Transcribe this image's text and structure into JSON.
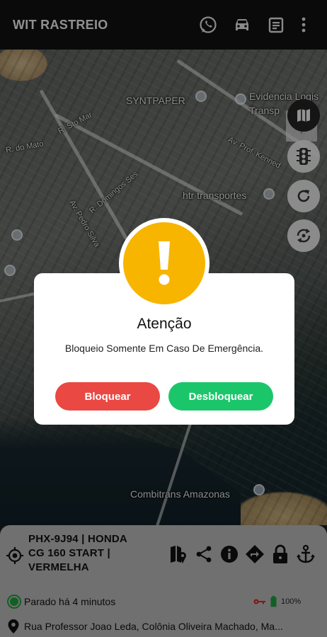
{
  "app": {
    "title": "WIT RASTREIO"
  },
  "toolbar": {
    "icons": [
      "whatsapp-icon",
      "car-icon",
      "calendar-icon",
      "more-vertical-icon"
    ]
  },
  "map": {
    "labels": {
      "syntpaper": "SYNTPAPER",
      "evidencia": "Evidencia Logis",
      "transp": "Transp",
      "htr": "htr transportes",
      "combitrans": "Combitrans Amazonas",
      "av_prof": "Av. Prof. Kenned",
      "st1": "R. Sto Mar",
      "st2": "R. Domingos Ses",
      "st3": "R. do Mato",
      "st4": "Av. Pedro Silva"
    },
    "buttons": [
      "location-icon",
      "map-layers-icon",
      "traffic-light-icon",
      "refresh-icon",
      "sync-icon"
    ]
  },
  "dialog": {
    "title": "Atenção",
    "message": "Bloqueio Somente Em Caso De Emergência.",
    "block_label": "Bloquear",
    "unblock_label": "Desbloquear",
    "icon": "exclamation-icon",
    "accent": "#f7b500"
  },
  "vehicle": {
    "line1": "PHX-9J94 | HONDA",
    "line2": "CG 160 START |",
    "line3": "VERMELHA",
    "status": "Parado há 4 minutos",
    "battery": "100%",
    "address": "Rua Professor Joao Leda, Colônia Oliveira Machado, Ma...",
    "tools": [
      "route-icon",
      "share-icon",
      "info-icon",
      "directions-icon",
      "lock-icon",
      "anchor-icon"
    ]
  },
  "colors": {
    "block": "#ea4843",
    "unblock": "#1bc66a",
    "status": "#1e9a3b"
  }
}
